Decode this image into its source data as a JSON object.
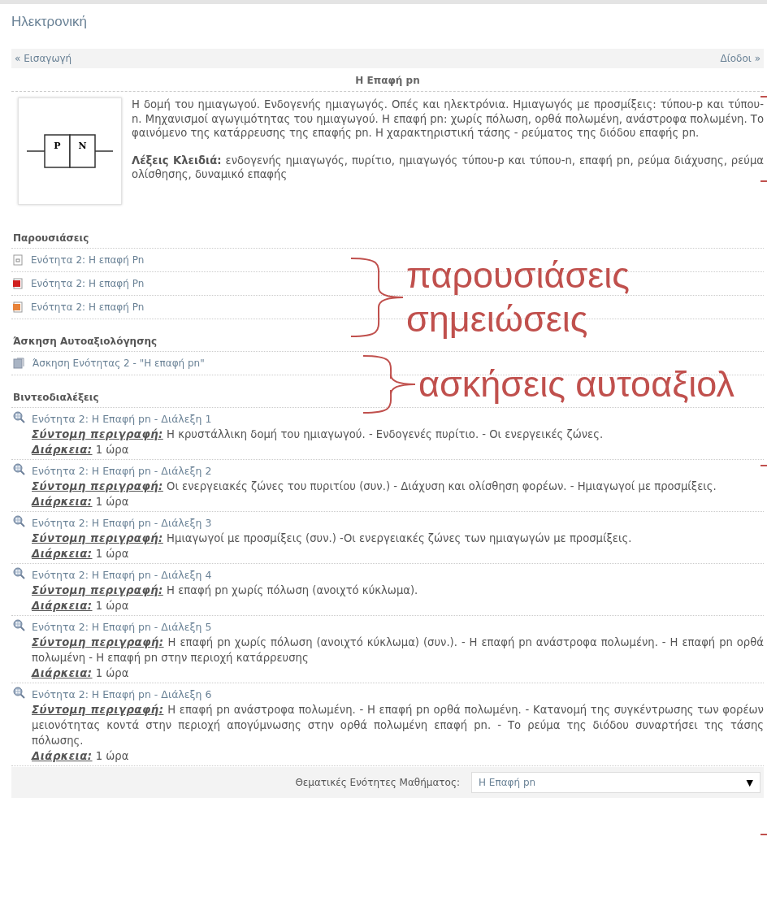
{
  "header": {
    "title": "Ηλεκτρονική"
  },
  "nav": {
    "previous": "« Εισαγωγή",
    "next": "Δίοδοι »"
  },
  "unit": {
    "title": "Η Επαφή pn",
    "image_labels": [
      "P",
      "N"
    ],
    "description": "Η δομή του ημιαγωγού. Ενδογενής ημιαγωγός. Οπές και ηλεκτρόνια. Ημιαγωγός με προσμίξεις: τύπου-p και τύπου-n. Μηχανισμοί αγωγιμότητας του ημιαγωγού. Η επαφή pn: χωρίς πόλωση, ορθά πολωμένη, ανάστροφα πολωμένη. Το φαινόμενο της κατάρρευσης της επαφής pn. Η χαρακτηριστική τάσης - ρεύματος της διόδου επαφής pn.",
    "keywords_label": "Λέξεις Κλειδιά:",
    "keywords": "ενδογενής ημιαγωγός, πυρίτιο, ημιαγωγός τύπου-p και τύπου-n, επαφή pn, ρεύμα διάχυσης, ρεύμα ολίσθησης, δυναμικό επαφής"
  },
  "sections": [
    {
      "kind": "files",
      "title": "Παρουσιάσεις",
      "items": [
        {
          "kind": "document",
          "label": "Ενότητα 2: Η επαφή Pn"
        },
        {
          "kind": "pdf",
          "label": "Ενότητα 2: Η επαφή Pn"
        },
        {
          "kind": "slides",
          "label": "Ενότητα 2: Η επαφή Pn"
        }
      ]
    },
    {
      "kind": "files",
      "title": "Άσκηση Αυτοαξιολόγησης",
      "items": [
        {
          "kind": "quiz",
          "label": "Άσκηση Ενότητας 2 - \"Η επαφή pn\""
        }
      ]
    },
    {
      "kind": "lectures",
      "title": "Βιντεοδιαλέξεις",
      "items": [
        {
          "title": "Ενότητα 2: Η Επαφή pn - Διάλεξη 1",
          "summary_label": "Σύντομη περιγραφή:",
          "summary": "Η κρυστάλλικη δομή του ημιαγωγού. - Ενδογενές πυρίτιο. - Οι ενεργεικές ζώνες.",
          "duration_label": "Διάρκεια:",
          "duration": "1 ώρα"
        },
        {
          "title": "Ενότητα 2: Η Επαφή pn - Διάλεξη 2",
          "summary_label": "Σύντομη περιγραφή:",
          "summary": "Οι ενεργειακές ζώνες του πυριτίου (συν.) - Διάχυση και ολίσθηση φορέων. - Ημιαγωγοί με προσμίξεις.",
          "duration_label": "Διάρκεια:",
          "duration": "1 ώρα"
        },
        {
          "title": "Ενότητα 2: Η Επαφή pn - Διάλεξη 3",
          "summary_label": "Σύντομη περιγραφή:",
          "summary": "Ημιαγωγοί με προσμίξεις (συν.) -Οι ενεργειακές ζώνες των ημιαγωγών με προσμίξεις.",
          "duration_label": "Διάρκεια:",
          "duration": "1 ώρα"
        },
        {
          "title": "Ενότητα 2: Η Επαφή pn - Διάλεξη 4",
          "summary_label": "Σύντομη περιγραφή:",
          "summary": "Η επαφή pn χωρίς πόλωση (ανοιχτό κύκλωμα).",
          "duration_label": "Διάρκεια:",
          "duration": "1 ώρα"
        },
        {
          "title": "Ενότητα 2: Η Επαφή pn - Διάλεξη 5",
          "summary_label": "Σύντομη περιγραφή:",
          "summary": "Η επαφή pn χωρίς πόλωση (ανοιχτό κύκλωμα) (συν.). - Η επαφή pn ανάστροφα πολωμένη. - Η επαφή pn ορθά πολωμένη - Η επαφή pn στην περιοχή κατάρρευσης",
          "duration_label": "Διάρκεια:",
          "duration": "1 ώρα"
        },
        {
          "title": "Ενότητα 2: Η Επαφή pn - Διάλεξη 6",
          "summary_label": "Σύντομη περιγραφή:",
          "summary": "Η επαφή pn ανάστροφα πολωμένη. - Η επαφή pn ορθά πολωμένη. - Κατανομή της συγκέντρωσης των φορέων μειονότητας κοντά στην περιοχή απογύμνωσης στην ορθά πολωμένη επαφή pn. - Το ρεύμα της διόδου συναρτήσει της τάσης πόλωσης.",
          "duration_label": "Διάρκεια:",
          "duration": "1 ώρα"
        }
      ]
    }
  ],
  "footer": {
    "label": "Θεματικές Ενότητες Μαθήματος:",
    "select_value": "Η Επαφή pn",
    "caret": "▼"
  },
  "annotations": [
    {
      "lines": [
        "παρουσιάσεις",
        "σημειώσεις"
      ]
    },
    {
      "lines": [
        "ασκήσεις  αυτοαξιολ"
      ]
    }
  ]
}
